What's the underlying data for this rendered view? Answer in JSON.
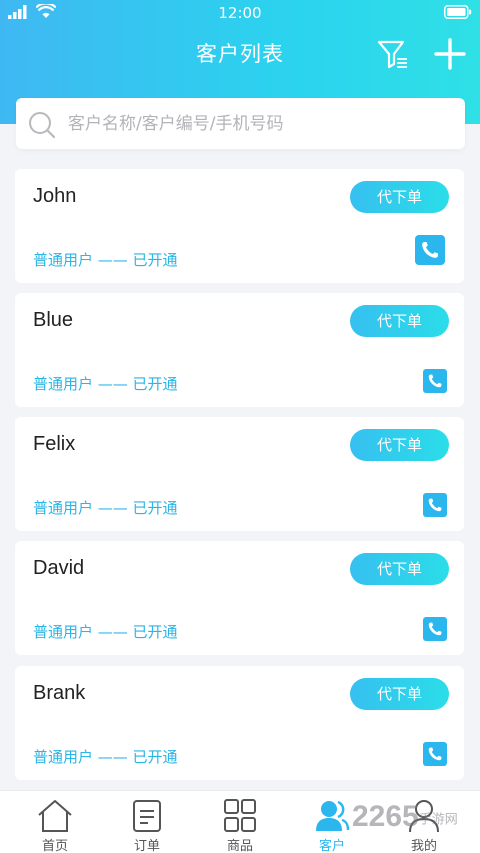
{
  "status_bar": {
    "time": "12:00"
  },
  "header": {
    "title": "客户列表"
  },
  "search": {
    "placeholder": "客户名称/客户编号/手机号码"
  },
  "customers": [
    {
      "name": "John",
      "status": "普通用户 —— 已开通",
      "order_label": "代下单"
    },
    {
      "name": "Blue",
      "status": "普通用户 —— 已开通",
      "order_label": "代下单"
    },
    {
      "name": "Felix",
      "status": "普通用户 —— 已开通",
      "order_label": "代下单"
    },
    {
      "name": "David",
      "status": "普通用户 —— 已开通",
      "order_label": "代下单"
    },
    {
      "name": "Brank",
      "status": "普通用户 —— 已开通",
      "order_label": "代下单"
    }
  ],
  "tabbar": {
    "items": [
      {
        "label": "首页",
        "icon": "home-icon"
      },
      {
        "label": "订单",
        "icon": "order-icon"
      },
      {
        "label": "商品",
        "icon": "grid-icon"
      },
      {
        "label": "客户",
        "icon": "customer-icon",
        "active": true
      },
      {
        "label": "我的",
        "icon": "profile-icon"
      }
    ]
  },
  "watermark": {
    "text": "2265",
    "suffix": "手游网"
  },
  "colors": {
    "accent": "#2bb7ee",
    "header_start": "#3fb8f2",
    "header_end": "#2fe0e6"
  }
}
